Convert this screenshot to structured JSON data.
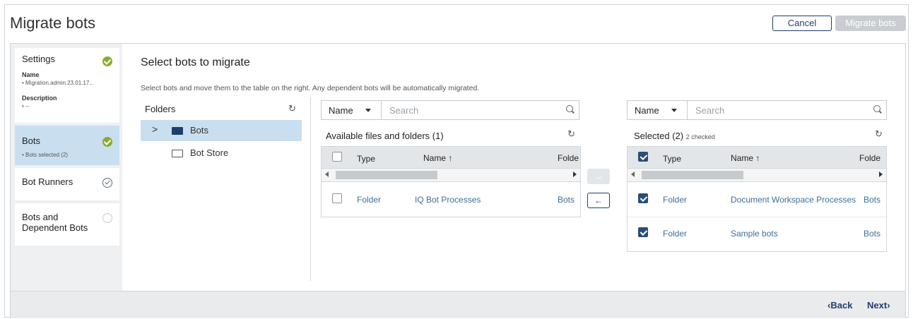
{
  "header": {
    "title": "Migrate bots",
    "cancel_label": "Cancel",
    "migrate_label": "Migrate bots"
  },
  "sidebar": {
    "settings": {
      "title": "Settings",
      "name_label": "Name",
      "name_value": "• Migration.admin.23.01.17...",
      "desc_label": "Description",
      "desc_value": "• --"
    },
    "bots": {
      "title": "Bots",
      "sub": "• Bots selected (2)"
    },
    "runners": {
      "title": "Bot Runners"
    },
    "dependent": {
      "title": "Bots and Dependent Bots"
    }
  },
  "main": {
    "title": "Select bots to migrate",
    "description": "Select bots and move them to the table on the right. Any dependent bots will be automatically migrated.",
    "folders_title": "Folders",
    "tree": [
      "Bots",
      "Bot Store"
    ]
  },
  "available": {
    "search_field": "Name",
    "search_placeholder": "Search",
    "title": "Available files and folders (1)",
    "columns": [
      "Type",
      "Name ↑",
      "Folde"
    ],
    "rows": [
      {
        "type": "Folder",
        "name": "IQ Bot Processes",
        "folder": "Bots"
      }
    ]
  },
  "selected": {
    "search_field": "Name",
    "search_placeholder": "Search",
    "title": "Selected (2)",
    "checked_note": "2 checked",
    "columns": [
      "Type",
      "Name ↑",
      "Folde"
    ],
    "rows": [
      {
        "type": "Folder",
        "name": "Document Workspace Processes",
        "folder": "Bots"
      },
      {
        "type": "Folder",
        "name": "Sample bots",
        "folder": "Bots"
      }
    ]
  },
  "footer": {
    "back_label": "Back",
    "next_label": "Next"
  }
}
